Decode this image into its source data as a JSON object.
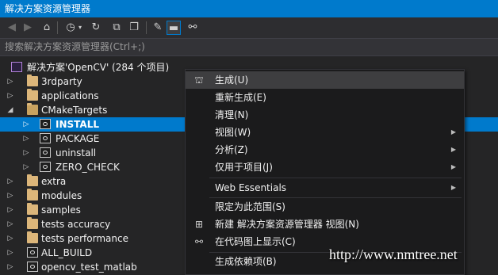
{
  "window": {
    "title": "解决方案资源管理器"
  },
  "toolbar": {
    "buttons": [
      "back-icon",
      "forward-icon",
      "home-icon",
      "history-icon",
      "dropdown-icon",
      "refresh-icon",
      "collapse-all-icon",
      "show-all-files-icon",
      "properties-icon",
      "preview-icon",
      "class-view-icon"
    ]
  },
  "search": {
    "placeholder": "搜索解决方案资源管理器(Ctrl+;)"
  },
  "tree": {
    "solution": {
      "label": "解决方案'OpenCV' (284 个项目)"
    },
    "items": [
      {
        "label": "3rdparty",
        "icon": "folder-icon",
        "expander": "▷",
        "level": 1
      },
      {
        "label": "applications",
        "icon": "folder-icon",
        "expander": "▷",
        "level": 1
      },
      {
        "label": "CMakeTargets",
        "icon": "folder-open-icon",
        "expander": "◢",
        "level": 1
      },
      {
        "label": "INSTALL",
        "icon": "project-icon",
        "expander": "▷",
        "level": 2,
        "selected": true
      },
      {
        "label": "PACKAGE",
        "icon": "project-icon",
        "expander": "▷",
        "level": 2
      },
      {
        "label": "uninstall",
        "icon": "project-icon",
        "expander": "▷",
        "level": 2
      },
      {
        "label": "ZERO_CHECK",
        "icon": "project-icon",
        "expander": "▷",
        "level": 2
      },
      {
        "label": "extra",
        "icon": "folder-icon",
        "expander": "▷",
        "level": 1
      },
      {
        "label": "modules",
        "icon": "folder-icon",
        "expander": "▷",
        "level": 1
      },
      {
        "label": "samples",
        "icon": "folder-icon",
        "expander": "▷",
        "level": 1
      },
      {
        "label": "tests accuracy",
        "icon": "folder-icon",
        "expander": "▷",
        "level": 1
      },
      {
        "label": "tests performance",
        "icon": "folder-icon",
        "expander": "▷",
        "level": 1
      },
      {
        "label": "ALL_BUILD",
        "icon": "project-icon",
        "expander": "▷",
        "level": 1
      },
      {
        "label": "opencv_test_matlab",
        "icon": "project-icon",
        "expander": "▷",
        "level": 1
      }
    ]
  },
  "context_menu": {
    "items": [
      {
        "label": "生成(U)",
        "icon": "build-icon",
        "highlighted": true
      },
      {
        "label": "重新生成(E)"
      },
      {
        "label": "清理(N)"
      },
      {
        "label": "视图(W)",
        "submenu": true
      },
      {
        "label": "分析(Z)",
        "submenu": true
      },
      {
        "label": "仅用于项目(J)",
        "submenu": true
      },
      {
        "separator": true
      },
      {
        "label": "Web Essentials",
        "submenu": true
      },
      {
        "separator": true
      },
      {
        "label": "限定为此范围(S)"
      },
      {
        "label": "新建 解决方案资源管理器 视图(N)",
        "icon": "new-view-icon"
      },
      {
        "label": "在代码图上显示(C)",
        "icon": "code-map-icon"
      },
      {
        "separator": true
      },
      {
        "label": "生成依赖项(B)"
      }
    ],
    "submenu_glyph": "▶"
  },
  "watermark": {
    "text": "http://www.nmtree.net"
  },
  "colors": {
    "accent": "#007acc",
    "background": "#252526",
    "menu_bg": "#1b1b1c",
    "folder": "#dcb67a"
  }
}
